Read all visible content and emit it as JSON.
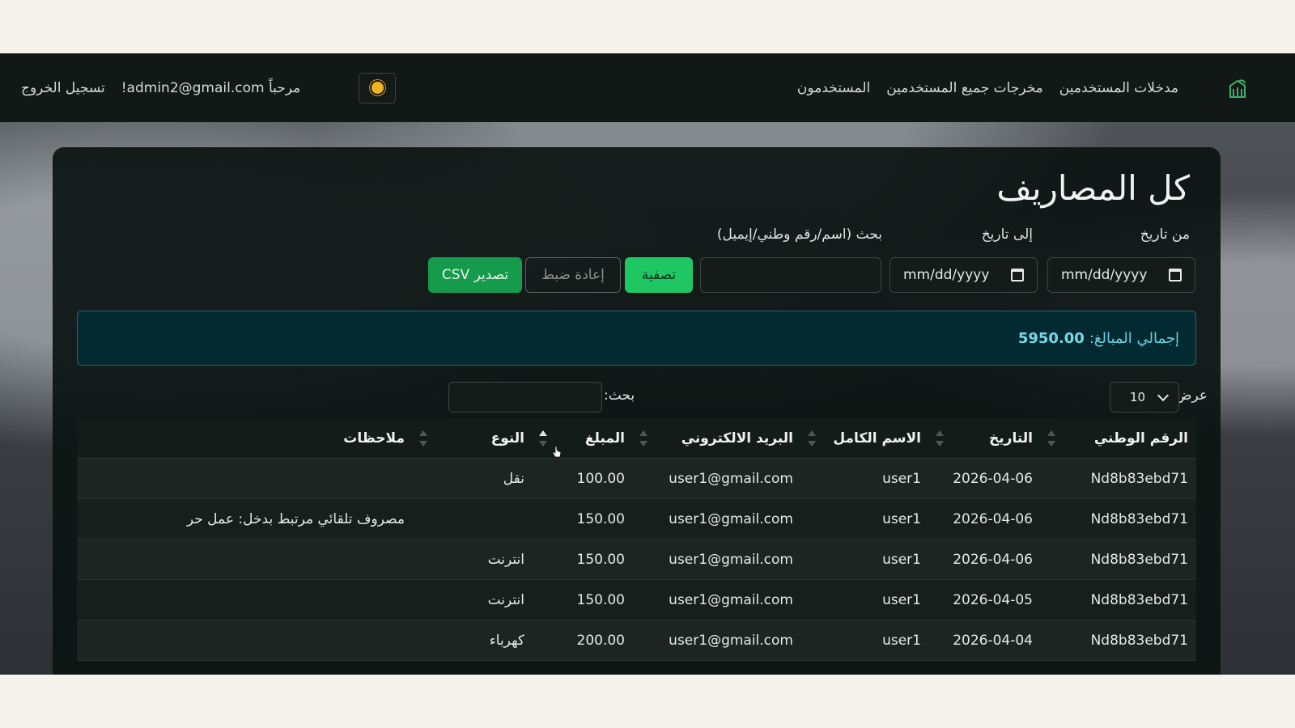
{
  "nav": {
    "links": [
      "مدخلات المستخدمين",
      "مخرجات جميع المستخدمين",
      "المستخدمون"
    ],
    "welcome": "مرحباً admin2@gmail.com!",
    "logout": "تسجيل الخروج",
    "brand_icon": "building-leaf-icon",
    "theme_icon": "sun-icon"
  },
  "page": {
    "title": "كل المصاريف",
    "from_label": "من تاريخ",
    "to_label": "إلى تاريخ",
    "search_label": "بحث (اسم/رقم وطني/إيميل)",
    "date_placeholder": "mm/dd/yyyy",
    "filter_label": "تصفية",
    "reset_label": "إعادة ضبط",
    "export_label": "تصدير CSV"
  },
  "total": {
    "label": "إجمالي المبالغ:",
    "value": "5950.00"
  },
  "table_controls": {
    "show_label": "عرض",
    "page_size": "10",
    "search_label": "بحث:"
  },
  "table": {
    "headers": [
      "الرقم الوطني",
      "التاريخ",
      "الاسم الكامل",
      "البريد الالكتروني",
      "المبلغ",
      "النوع",
      "ملاحظات"
    ],
    "rows": [
      [
        "Nd8b83ebd71",
        "2026-04-06",
        "user1",
        "user1@gmail.com",
        "100.00",
        "نقل",
        ""
      ],
      [
        "Nd8b83ebd71",
        "2026-04-06",
        "user1",
        "user1@gmail.com",
        "150.00",
        "",
        "مصروف تلقائي مرتبط بدخل: عمل حر"
      ],
      [
        "Nd8b83ebd71",
        "2026-04-06",
        "user1",
        "user1@gmail.com",
        "150.00",
        "انترنت",
        ""
      ],
      [
        "Nd8b83ebd71",
        "2026-04-05",
        "user1",
        "user1@gmail.com",
        "150.00",
        "انترنت",
        ""
      ],
      [
        "Nd8b83ebd71",
        "2026-04-04",
        "user1",
        "user1@gmail.com",
        "200.00",
        "كهرباء",
        ""
      ]
    ]
  },
  "colors": {
    "accent": "#1fc763",
    "export": "#169a4b",
    "info": "#66d1df",
    "nav_bg": "#121815"
  }
}
